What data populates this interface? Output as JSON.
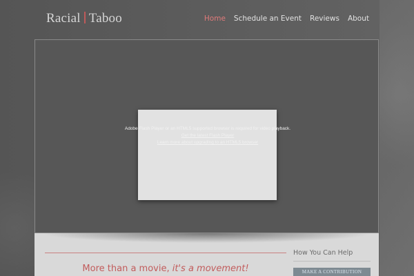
{
  "header": {
    "logo": {
      "word1": "Racial",
      "word2": "Taboo"
    },
    "nav": [
      {
        "label": "Home",
        "active": true
      },
      {
        "label": "Schedule an Event",
        "active": false
      },
      {
        "label": "Reviews",
        "active": false
      },
      {
        "label": "About",
        "active": false
      }
    ]
  },
  "video": {
    "message": "Adobe Flash Player or an HTML5 supported browser is required for video playback.",
    "link1": "Get the latest Flash Player",
    "link2": "Learn more about upgrading to an HTML5 browser"
  },
  "content": {
    "tagline_main": "More than a movie, ",
    "tagline_emphasis": "it's a movement!"
  },
  "sidebar": {
    "heading": "How You Can Help",
    "button": "MAKE A CONTRIBUTION"
  },
  "colors": {
    "accent": "#c25c5c",
    "nav_active": "#e07a7a"
  }
}
